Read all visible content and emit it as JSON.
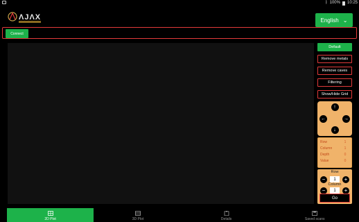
{
  "status": {
    "battery_percent": "100%",
    "time": "10:25"
  },
  "header": {
    "language": "English"
  },
  "connect": {
    "label": "Connect"
  },
  "side_panel": {
    "buttons": [
      "Default",
      "Remove metals",
      "Remove caves",
      "Filtering",
      "Show/Hide Grid"
    ],
    "info": [
      {
        "label": "Row",
        "value": "1"
      },
      {
        "label": "Column",
        "value": "1"
      },
      {
        "label": "Depth",
        "value": "0"
      },
      {
        "label": "Value",
        "value": "0"
      }
    ],
    "row_label": "Row",
    "row_value": "1",
    "column_label": "Column",
    "column_value": "1",
    "go_label": "Go"
  },
  "nav": {
    "tabs": [
      "2D Plot",
      "3D Plot",
      "Details",
      "Saved scans"
    ]
  },
  "colors": {
    "accent_green": "#1db24a",
    "border_red": "#e23a3a",
    "panel_orange": "#f0b36a"
  }
}
